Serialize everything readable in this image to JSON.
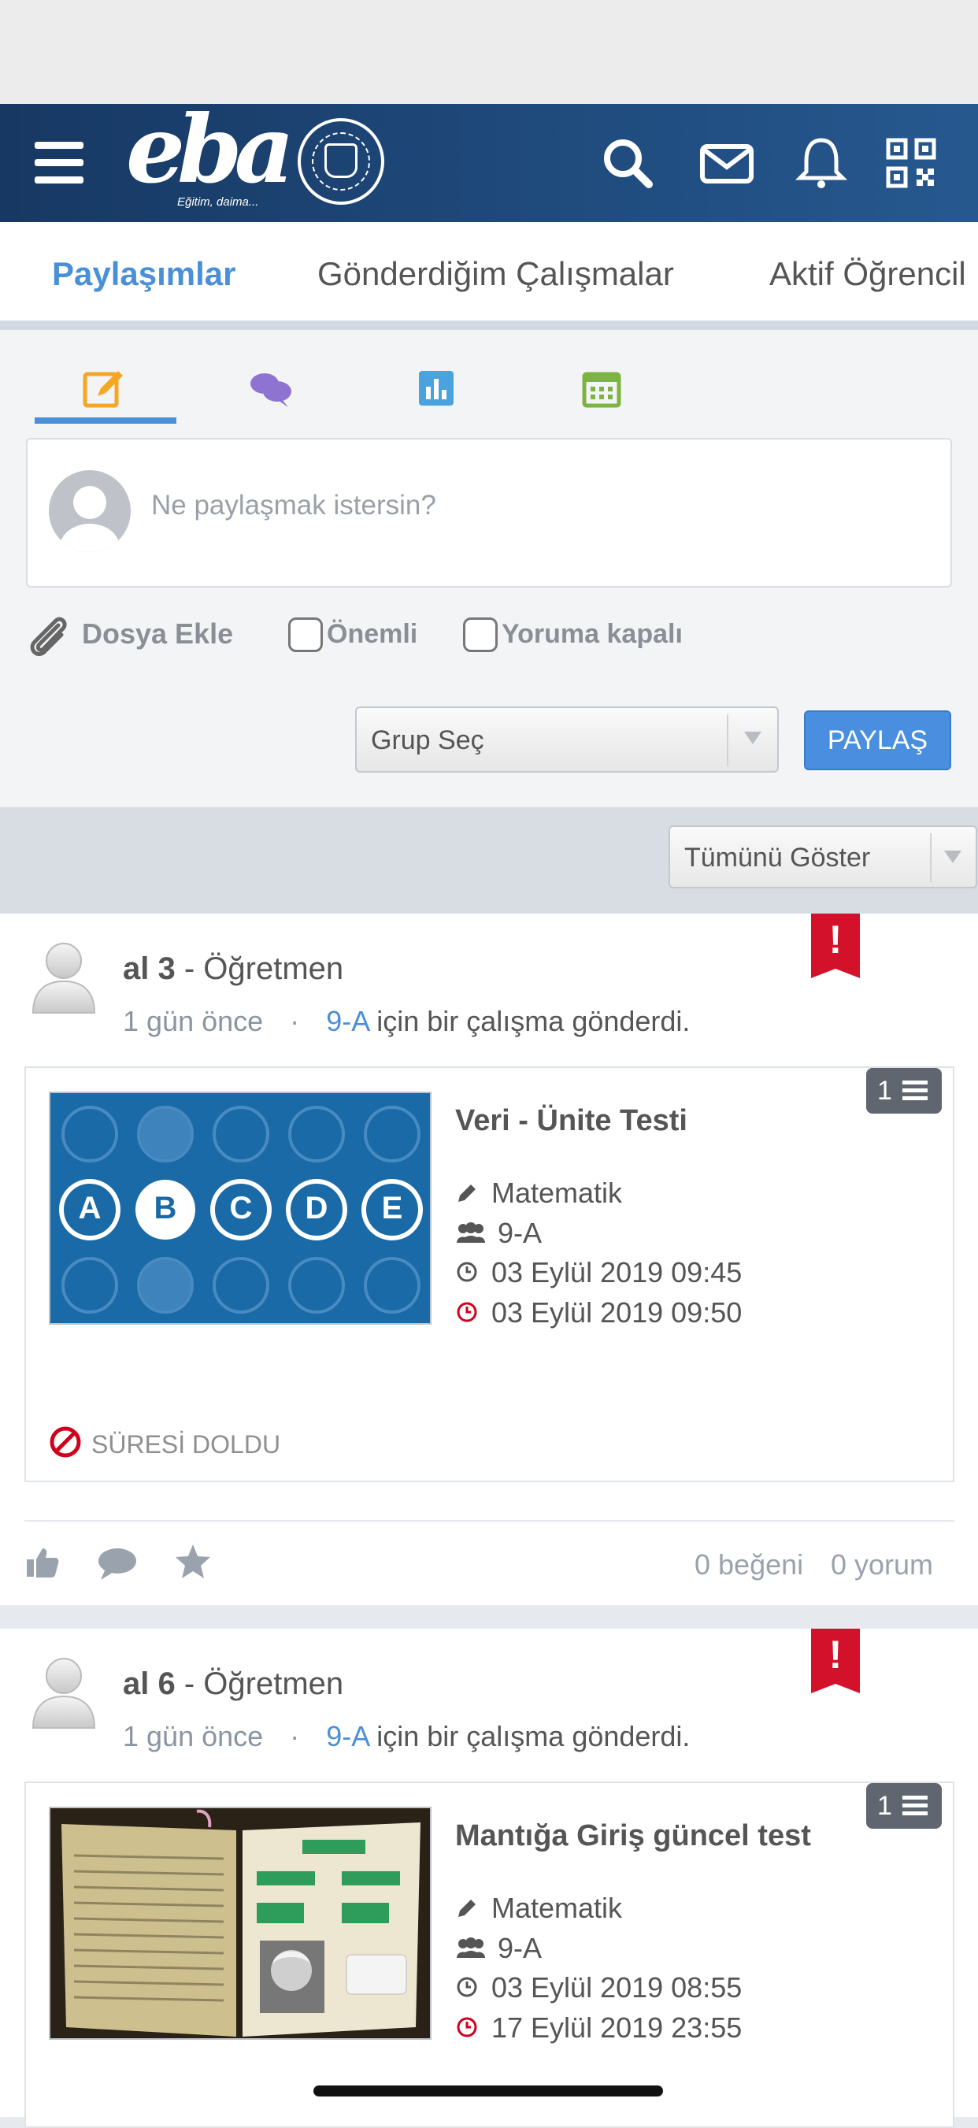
{
  "app": {
    "logo_text": "eba",
    "logo_tagline": "Eğitim, daima..."
  },
  "tabs": [
    {
      "label": "Paylaşımlar",
      "active": true
    },
    {
      "label": "Gönderdiğim Çalışmalar",
      "active": false
    },
    {
      "label": "Aktif Öğrencil",
      "active": false
    }
  ],
  "composer": {
    "tab_icons": [
      "edit-icon",
      "chat-icon",
      "chart-icon",
      "calendar-icon"
    ],
    "placeholder": "Ne paylaşmak istersin?",
    "attach_label": "Dosya Ekle",
    "important_label": "Önemli",
    "comments_closed_label": "Yoruma kapalı",
    "group_select": "Grup Seç",
    "share_button": "PAYLAŞ"
  },
  "filter": {
    "selected": "Tümünü Göster"
  },
  "posts": [
    {
      "user": "al 3",
      "role": "- Öğretmen",
      "time": "1 gün önce",
      "dot": "·",
      "group": "9-A",
      "action": "için bir çalışma gönderdi.",
      "count": "1",
      "title": "Veri - Ünite Testi",
      "subject": "Matematik",
      "class": "9-A",
      "start": "03 Eylül 2019 09:45",
      "end": "03 Eylül 2019 09:50",
      "status": "SÜRESİ DOLDU",
      "likes": "0 beğeni",
      "comments": "0 yorum",
      "thumb_letters": [
        "A",
        "B",
        "C",
        "D",
        "E"
      ]
    },
    {
      "user": "al 6",
      "role": "- Öğretmen",
      "time": "1 gün önce",
      "dot": "·",
      "group": "9-A",
      "action": "için bir çalışma gönderdi.",
      "count": "1",
      "title": "Mantığa Giriş güncel test",
      "subject": "Matematik",
      "class": "9-A",
      "start": "03 Eylül 2019 08:55",
      "end": "17 Eylül 2019 23:55"
    }
  ],
  "colors": {
    "nav": "#1f4a7c",
    "accent": "#4a90d9",
    "flag": "#d4112a"
  }
}
